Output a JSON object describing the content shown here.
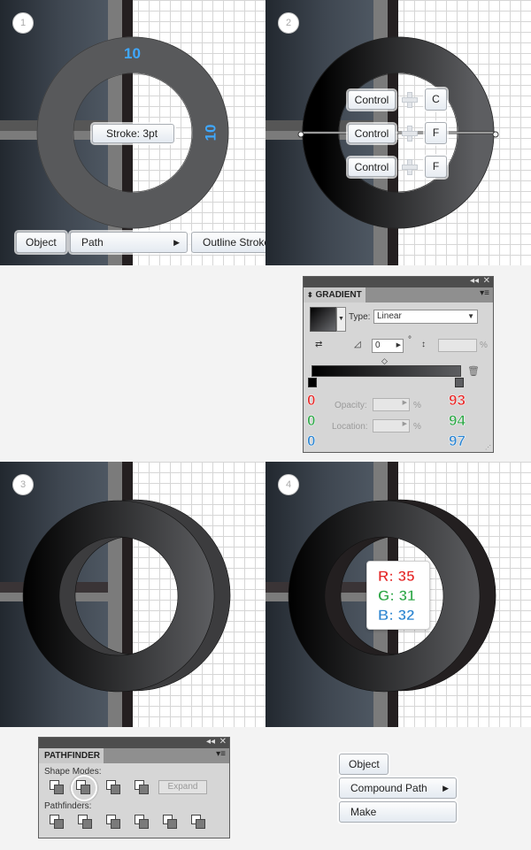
{
  "panel1": {
    "step": "1",
    "dim_top": "10",
    "dim_right": "10",
    "stroke_label": "Stroke: 3pt",
    "menu": {
      "object": "Object",
      "path": "Path",
      "outline_stroke": "Outline Stroke"
    }
  },
  "panel2": {
    "step": "2",
    "shortcuts": [
      {
        "modifier": "Control",
        "key": "C"
      },
      {
        "modifier": "Control",
        "key": "F"
      },
      {
        "modifier": "Control",
        "key": "F"
      }
    ]
  },
  "gradient": {
    "title": "GRADIENT",
    "type_label": "Type:",
    "type_value": "Linear",
    "angle_value": "0",
    "degree": "°",
    "opacity_label": "Opacity:",
    "location_label": "Location:",
    "percent": "%",
    "left_stop": {
      "r": "0",
      "g": "0",
      "b": "0"
    },
    "right_stop": {
      "r": "93",
      "g": "94",
      "b": "97"
    },
    "colors": {
      "red": "#e52a2a",
      "green": "#31a84a",
      "blue": "#2e86d1"
    }
  },
  "panel3": {
    "step": "3"
  },
  "panel4": {
    "step": "4",
    "rgb": {
      "r": "R: 35",
      "g": "G: 31",
      "b": "B: 32"
    }
  },
  "pathfinder": {
    "title": "PATHFINDER",
    "shape_modes": "Shape Modes:",
    "expand": "Expand",
    "pathfinders": "Pathfinders:"
  },
  "menu2": {
    "object": "Object",
    "compound_path": "Compound Path",
    "make": "Make"
  }
}
